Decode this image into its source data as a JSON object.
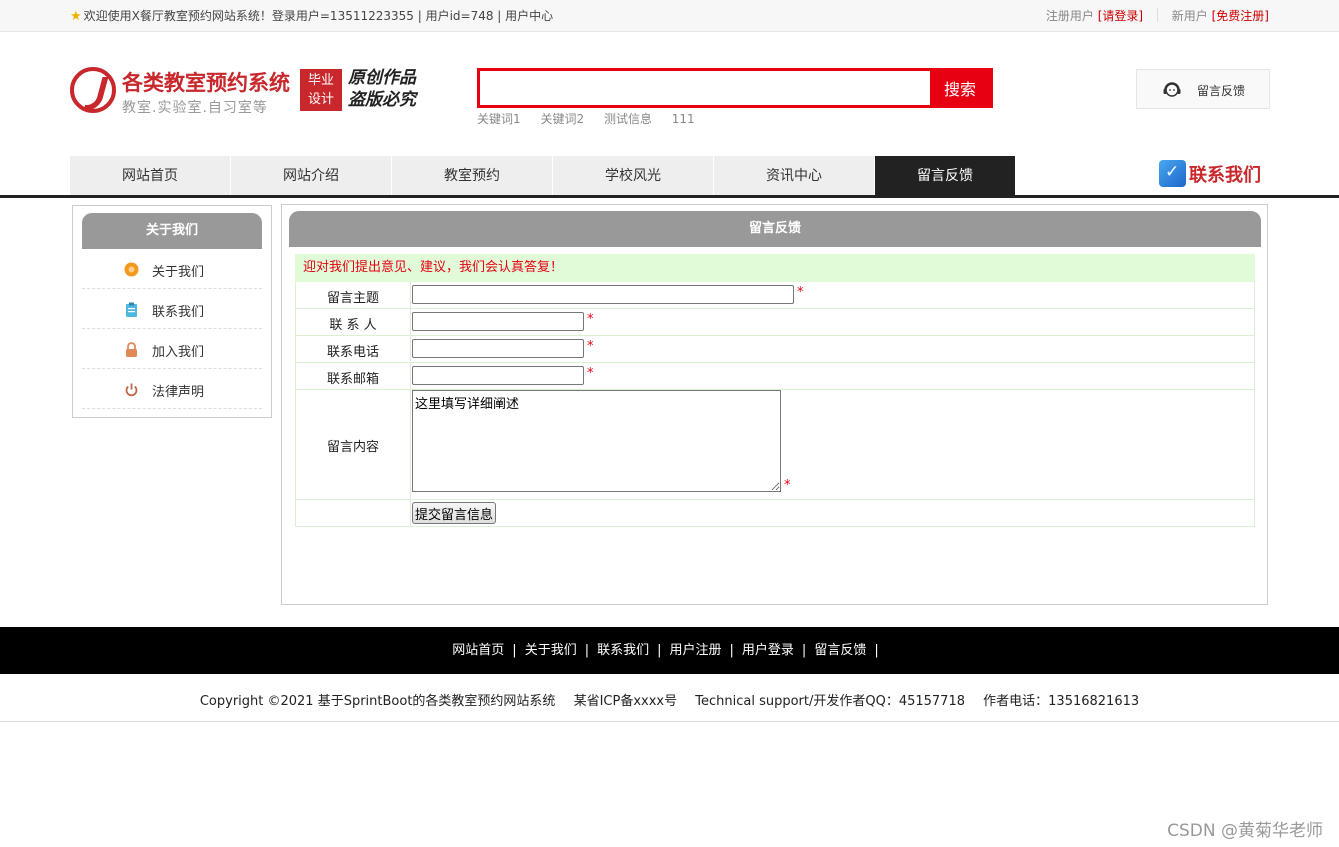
{
  "topbar": {
    "welcome": "欢迎使用X餐厅教室预约网站系统！登录用户=13511223355 | 用户id=748 | 用户中心",
    "registered_label": "注册用户",
    "login_link": "[请登录]",
    "new_user_label": "新用户",
    "signup_link": "[免费注册]"
  },
  "header": {
    "logo_title": "各类教室预约系统",
    "logo_subtitle": "教室.实验室.自习室等",
    "badge_line1": "毕业",
    "badge_line2": "设计",
    "sign_line1": "原创作品",
    "sign_line2": "盗版必究",
    "search_value": "",
    "search_button": "搜索",
    "keywords": [
      "关键词1",
      "关键词2",
      "测试信息",
      "111"
    ],
    "feedback_button": "留言反馈"
  },
  "nav": {
    "items": [
      "网站首页",
      "网站介绍",
      "教室预约",
      "学校风光",
      "资讯中心",
      "留言反馈"
    ],
    "active_index": 5,
    "contact_us": "联系我们"
  },
  "sidebar": {
    "title": "关于我们",
    "items": [
      {
        "label": "关于我们",
        "icon": "orange-circle-icon"
      },
      {
        "label": "联系我们",
        "icon": "clipboard-icon"
      },
      {
        "label": "加入我们",
        "icon": "lock-icon"
      },
      {
        "label": "法律声明",
        "icon": "power-icon"
      }
    ]
  },
  "form": {
    "title": "留言反馈",
    "notice": "迎对我们提出意见、建议，我们会认真答复！",
    "subject_label": "留言主题",
    "contact_label": "联 系 人",
    "phone_label": "联系电话",
    "email_label": "联系邮箱",
    "content_label": "留言内容",
    "content_value": "这里填写详细阐述",
    "required_mark": "*",
    "submit": "提交留言信息"
  },
  "footer": {
    "links": [
      "网站首页",
      "关于我们",
      "联系我们",
      "用户注册",
      "用户登录",
      "留言反馈"
    ],
    "separator": "|",
    "copyright": "Copyright ©2021 基于SprintBoot的各类教室预约网站系统",
    "icp": "某省ICP备xxxx号",
    "support": "Technical support/开发作者QQ：45157718",
    "phone": "作者电话：13516821613"
  },
  "watermark": "CSDN @黄菊华老师",
  "colors": {
    "brand_red": "#c8282c",
    "search_red": "#e60012",
    "nav_active": "#222222",
    "panel_head": "#999999",
    "notice_bg": "#e1fbd9"
  }
}
